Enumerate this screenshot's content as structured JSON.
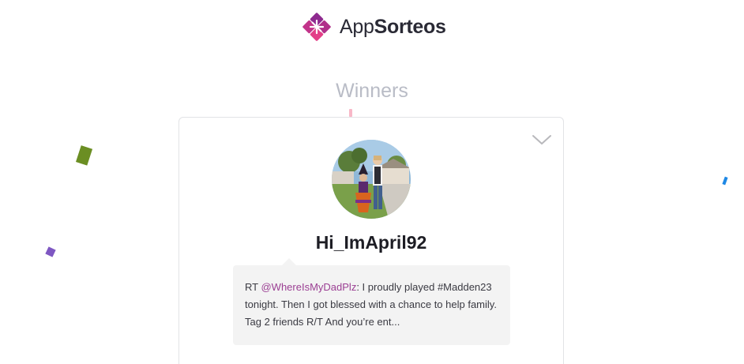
{
  "brand": {
    "name_light": "App",
    "name_bold": "Sorteos",
    "colors": {
      "mark_dark": "#8e2a8f",
      "mark_mid": "#b0308a",
      "mark_light": "#e33f88"
    }
  },
  "section": {
    "title": "Winners"
  },
  "winner": {
    "username": "Hi_ImApril92",
    "avatar_icon": "profile-photo",
    "tweet": {
      "prefix": "RT ",
      "mention": "@WhereIsMyDadPlz",
      "body": ": I proudly played #Madden23 tonight. Then I got blessed with a chance to help family. Tag 2 friends R/T And you’re ent..."
    },
    "expand_icon": "chevron-down-icon"
  },
  "confetti_colors": [
    "#6b8e23",
    "#1e88e5",
    "#f5d800",
    "#7e57c2",
    "#f8b8c8"
  ]
}
